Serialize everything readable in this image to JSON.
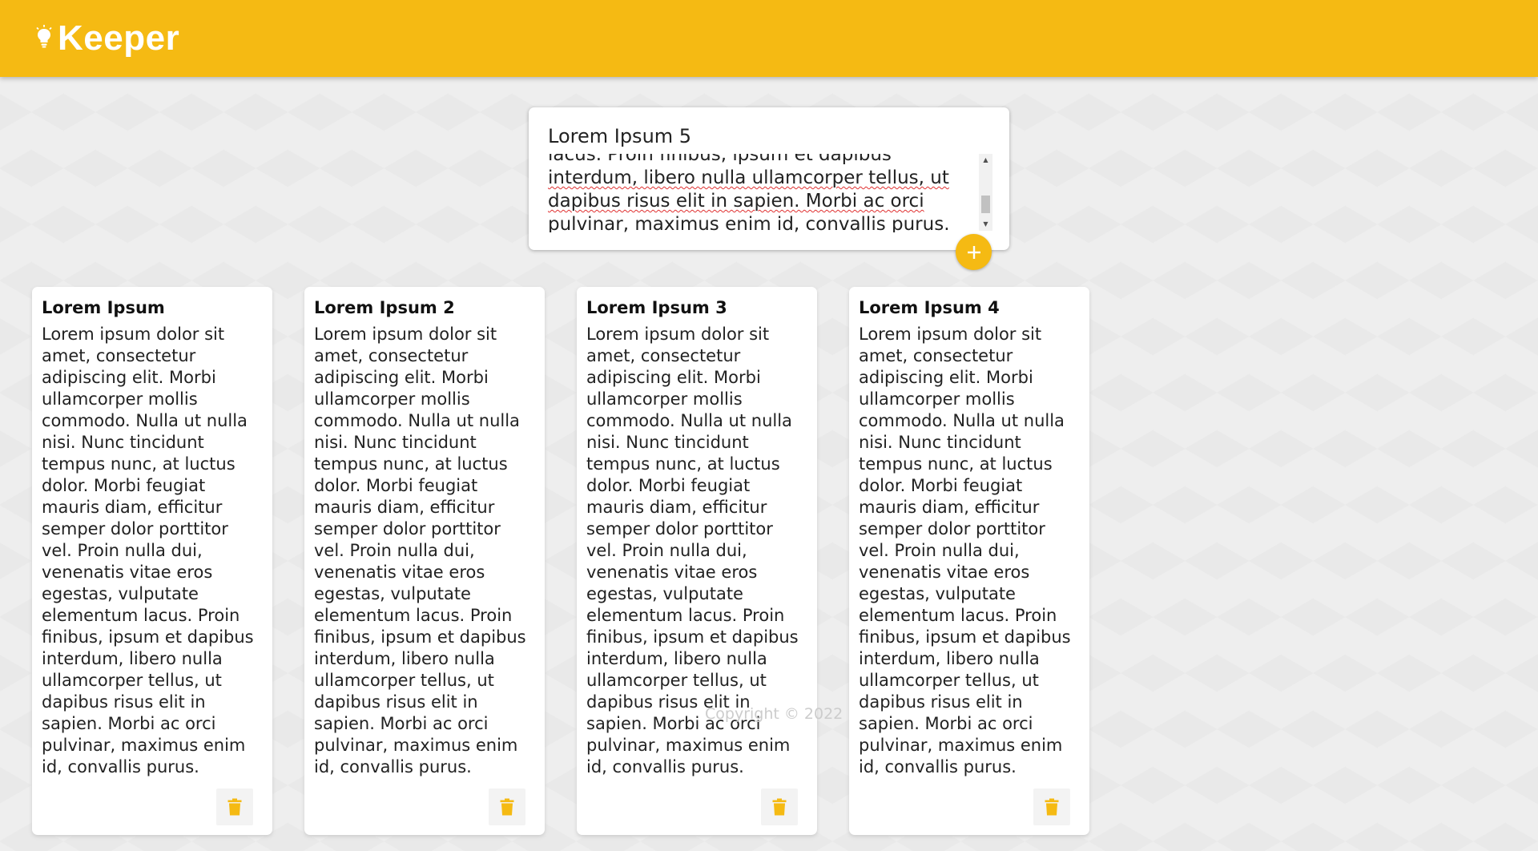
{
  "header": {
    "app_name": "Keeper",
    "icon": "lightbulb-icon"
  },
  "create_area": {
    "title_value": "Lorem Ipsum 5",
    "content_visible_lines": [
      "lacus. Proin finibus, ipsum et dapibus",
      "interdum, libero nulla ullamcorper tellus, ut",
      "dapibus risus elit in sapien. Morbi ac orci",
      "pulvinar, maximus enim id, convallis purus."
    ],
    "add_icon": "plus-icon"
  },
  "notes": [
    {
      "title": "Lorem Ipsum",
      "content": "Lorem ipsum dolor sit amet, consectetur adipiscing elit. Morbi ullamcorper mollis commodo. Nulla ut nulla nisi. Nunc tincidunt tempus nunc, at luctus dolor. Morbi feugiat mauris diam, efficitur semper dolor porttitor vel. Proin nulla dui, venenatis vitae eros egestas, vulputate elementum lacus. Proin finibus, ipsum et dapibus interdum, libero nulla ullamcorper tellus, ut dapibus risus elit in sapien. Morbi ac orci pulvinar, maximus enim id, convallis purus.",
      "delete_icon": "trash-icon"
    },
    {
      "title": "Lorem Ipsum 2",
      "content": "Lorem ipsum dolor sit amet, consectetur adipiscing elit. Morbi ullamcorper mollis commodo. Nulla ut nulla nisi. Nunc tincidunt tempus nunc, at luctus dolor. Morbi feugiat mauris diam, efficitur semper dolor porttitor vel. Proin nulla dui, venenatis vitae eros egestas, vulputate elementum lacus. Proin finibus, ipsum et dapibus interdum, libero nulla ullamcorper tellus, ut dapibus risus elit in sapien. Morbi ac orci pulvinar, maximus enim id, convallis purus.",
      "delete_icon": "trash-icon"
    },
    {
      "title": "Lorem Ipsum 3",
      "content": "Lorem ipsum dolor sit amet, consectetur adipiscing elit. Morbi ullamcorper mollis commodo. Nulla ut nulla nisi. Nunc tincidunt tempus nunc, at luctus dolor. Morbi feugiat mauris diam, efficitur semper dolor porttitor vel. Proin nulla dui, venenatis vitae eros egestas, vulputate elementum lacus. Proin finibus, ipsum et dapibus interdum, libero nulla ullamcorper tellus, ut dapibus risus elit in sapien. Morbi ac orci pulvinar, maximus enim id, convallis purus.",
      "delete_icon": "trash-icon"
    },
    {
      "title": "Lorem Ipsum 4",
      "content": "Lorem ipsum dolor sit amet, consectetur adipiscing elit. Morbi ullamcorper mollis commodo. Nulla ut nulla nisi. Nunc tincidunt tempus nunc, at luctus dolor. Morbi feugiat mauris diam, efficitur semper dolor porttitor vel. Proin nulla dui, venenatis vitae eros egestas, vulputate elementum lacus. Proin finibus, ipsum et dapibus interdum, libero nulla ullamcorper tellus, ut dapibus risus elit in sapien. Morbi ac orci pulvinar, maximus enim id, convallis purus.",
      "delete_icon": "trash-icon"
    }
  ],
  "footer": {
    "text": "Copyright © 2022"
  },
  "colors": {
    "accent": "#f5ba13",
    "background": "#eeeeee",
    "card": "#ffffff",
    "footer_text": "#cccccc"
  }
}
